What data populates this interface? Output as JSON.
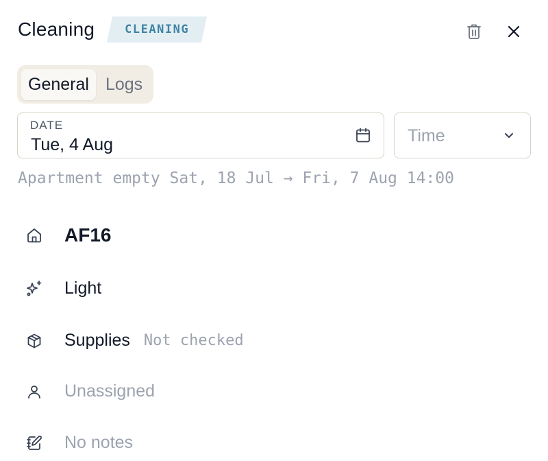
{
  "header": {
    "title": "Cleaning",
    "type_badge": "CLEANING",
    "delete_icon": "trash-icon",
    "close_icon": "close-icon"
  },
  "tabs": [
    {
      "label": "General",
      "active": true
    },
    {
      "label": "Logs",
      "active": false
    }
  ],
  "date_field": {
    "label": "DATE",
    "value": "Tue, 4 Aug",
    "icon": "calendar-icon"
  },
  "time_field": {
    "placeholder": "Time",
    "icon": "chevron-down-icon"
  },
  "vacancy_text": "Apartment empty Sat, 18 Jul → Fri, 7 Aug 14:00",
  "details": {
    "apartment": {
      "icon": "home-icon",
      "value": "AF16"
    },
    "cleaning_type": {
      "icon": "sparkles-icon",
      "value": "Light"
    },
    "supplies": {
      "icon": "package-icon",
      "label": "Supplies",
      "status": "Not checked"
    },
    "assignee": {
      "icon": "user-icon",
      "value": "Unassigned"
    },
    "notes": {
      "icon": "notebook-pen-icon",
      "value": "No notes"
    }
  },
  "colors": {
    "badge_bg": "#e3eef3",
    "badge_text": "#3f84a3",
    "tabs_bg": "#f1ede4",
    "field_border": "#d8d4c8",
    "muted_text": "#9ca3af"
  }
}
